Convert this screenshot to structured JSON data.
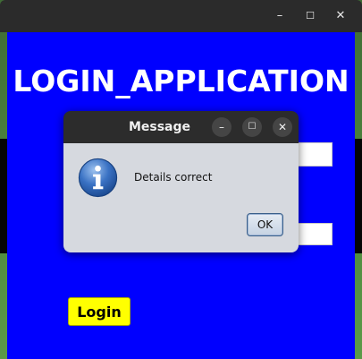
{
  "app": {
    "window_title": "",
    "heading": "LOGIN_APPLICATION",
    "login_label": "Login",
    "minimize_glyph": "–",
    "maximize_glyph": "☐",
    "close_glyph": "✕",
    "bg_color": "#0000ff",
    "login_button_color": "#ffff00"
  },
  "dialog": {
    "title": "Message",
    "message": "Details correct",
    "ok_label": "OK",
    "icon": "information-icon",
    "minimize_glyph": "–",
    "maximize_glyph": "☐",
    "close_glyph": "✕"
  }
}
